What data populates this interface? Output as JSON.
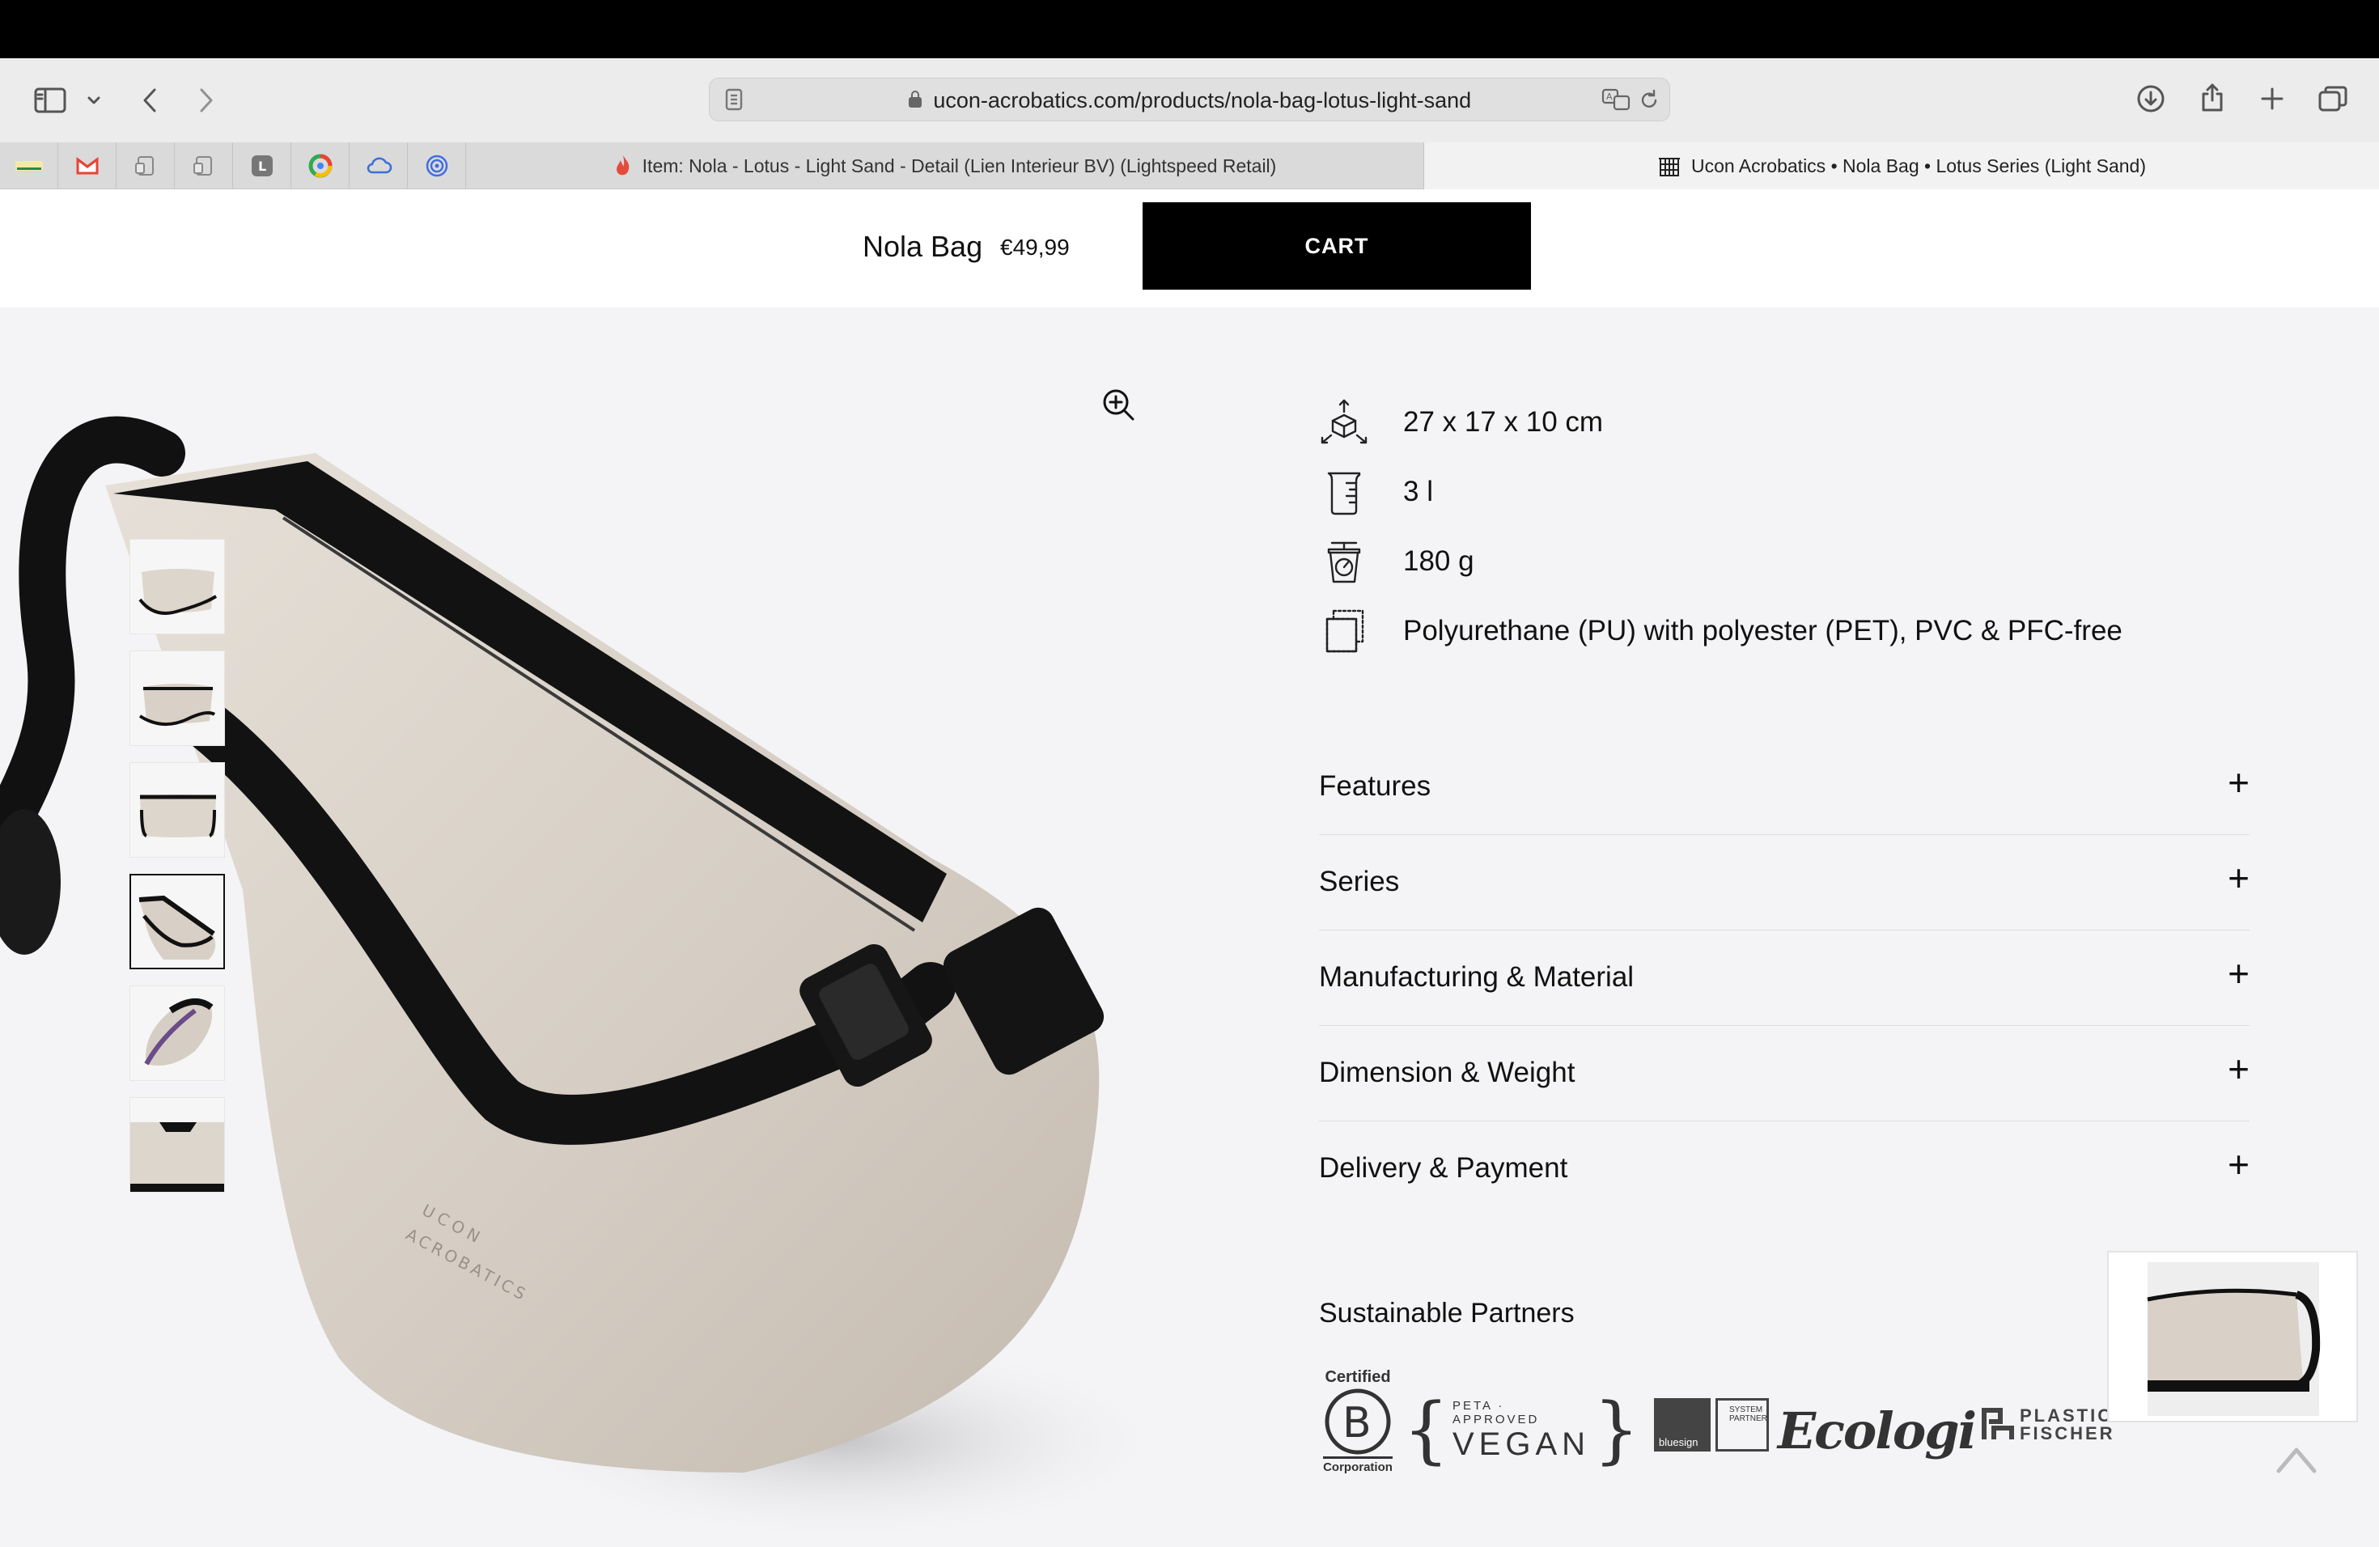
{
  "browser": {
    "url": "ucon-acrobatics.com/products/nola-bag-lotus-light-sand",
    "tabs": [
      {
        "label": "Item: Nola - Lotus - Light Sand - Detail (Lien Interieur BV) (Lightspeed Retail)",
        "active": false
      },
      {
        "label": "Ucon Acrobatics • Nola Bag • Lotus Series (Light Sand)",
        "active": true
      }
    ],
    "pinned_tab_icons": [
      "site-icon",
      "gmail-icon",
      "document-icon",
      "document-icon",
      "letter-l-icon",
      "chrome-icon",
      "cloud-icon",
      "swirl-icon"
    ]
  },
  "sticky": {
    "product_name": "Nola Bag",
    "price": "€49,99",
    "cart_label": "CART"
  },
  "specs": [
    {
      "icon": "dimensions-icon",
      "text": "27 x 17 x 10 cm"
    },
    {
      "icon": "volume-icon",
      "text": "3 l"
    },
    {
      "icon": "weight-icon",
      "text": "180 g"
    },
    {
      "icon": "material-icon",
      "text": "Polyurethane (PU) with polyester (PET), PVC & PFC-free"
    }
  ],
  "accordion": [
    {
      "label": "Features"
    },
    {
      "label": "Series"
    },
    {
      "label": "Manufacturing & Material"
    },
    {
      "label": "Dimension & Weight"
    },
    {
      "label": "Delivery & Payment"
    }
  ],
  "partners": {
    "title": "Sustainable Partners",
    "bcorp": {
      "top": "Certified",
      "bottom": "Corporation"
    },
    "vegan": {
      "small": "PETA · APPROVED",
      "big": "VEGAN"
    },
    "bluesign": {
      "left": "bluesign",
      "right": "SYSTEM PARTNER"
    },
    "ecologi": "Ecologi",
    "plastic_fischer": {
      "line1": "PLASTIC",
      "line2": "FISCHER"
    }
  },
  "gallery": {
    "thumbnail_count": 6,
    "selected_thumbnail": 4
  }
}
